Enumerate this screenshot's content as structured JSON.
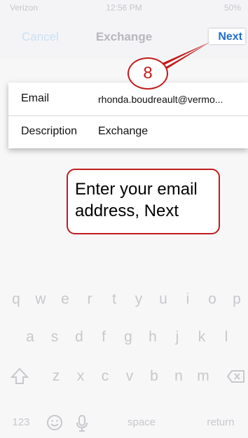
{
  "status_bar": {
    "carrier": "Verizon",
    "time": "12:56 PM",
    "battery": "50%"
  },
  "navbar": {
    "cancel_label": "Cancel",
    "title": "Exchange",
    "next_label": "Next"
  },
  "form": {
    "fields": [
      {
        "label": "Email",
        "value": "rhonda.boudreault@vermo..."
      },
      {
        "label": "Description",
        "value": "Exchange"
      }
    ]
  },
  "annotation": {
    "step_number": "8",
    "tooltip_text": "Enter your email address, Next"
  },
  "keyboard": {
    "row1": [
      "q",
      "w",
      "e",
      "r",
      "t",
      "y",
      "u",
      "i",
      "o",
      "p"
    ],
    "row2": [
      "a",
      "s",
      "d",
      "f",
      "g",
      "h",
      "j",
      "k",
      "l"
    ],
    "row3": [
      "z",
      "x",
      "c",
      "v",
      "b",
      "n",
      "m"
    ],
    "numbers_label": "123",
    "space_label": "space",
    "return_label": "return",
    "shift_icon": "shift-icon",
    "emoji_icon": "emoji-icon",
    "mic_icon": "microphone-icon",
    "delete_icon": "delete-icon"
  },
  "colors": {
    "accent": "#1f6fcf",
    "annotation_red": "#c21b1b"
  }
}
